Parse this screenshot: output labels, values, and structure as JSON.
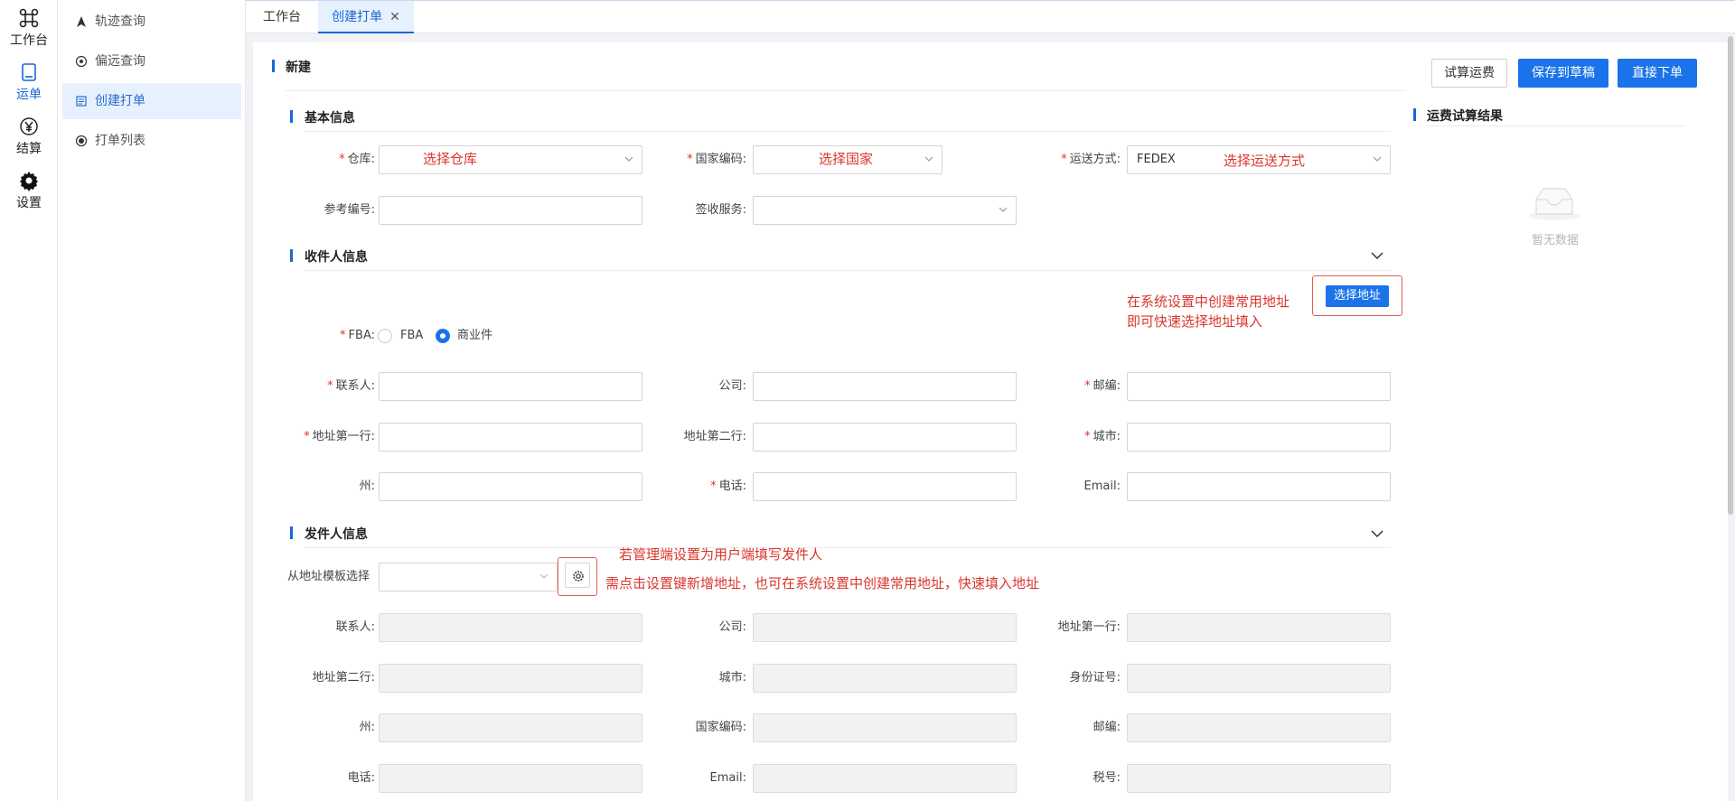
{
  "rail": {
    "items": [
      {
        "label": "工作台",
        "icon": "command-icon"
      },
      {
        "label": "运单",
        "icon": "tablet-icon"
      },
      {
        "label": "结算",
        "icon": "yen-icon"
      },
      {
        "label": "设置",
        "icon": "gear-icon"
      }
    ]
  },
  "submenu": {
    "items": [
      {
        "label": "轨迹查询"
      },
      {
        "label": "偏远查询"
      },
      {
        "label": "创建打单"
      },
      {
        "label": "打单列表"
      }
    ]
  },
  "tabs": [
    {
      "label": "工作台"
    },
    {
      "label": "创建打单"
    }
  ],
  "page": {
    "title": "新建",
    "buttons": {
      "trial": "试算运费",
      "save_draft": "保存到草稿",
      "submit": "直接下单"
    }
  },
  "basic": {
    "title": "基本信息",
    "warehouse_label": "仓库",
    "warehouse_hint": "选择仓库",
    "country_label": "国家编码",
    "country_hint": "选择国家",
    "shipping_label": "运送方式",
    "shipping_value": "FEDEX",
    "shipping_hint": "选择运送方式",
    "ref_label": "参考编号",
    "sign_label": "签收服务"
  },
  "recipient": {
    "title": "收件人信息",
    "choose_address_button": "选择地址",
    "annotation_line1": "在系统设置中创建常用地址",
    "annotation_line2": "即可快速选择地址填入",
    "fba_label": "FBA",
    "fba_option_fba": "FBA",
    "fba_option_commercial": "商业件",
    "contact_label": "联系人",
    "company_label": "公司",
    "postcode_label": "邮编",
    "addr1_label": "地址第一行",
    "addr2_label": "地址第二行",
    "city_label": "城市",
    "state_label": "州",
    "phone_label": "电话",
    "email_label": "Email"
  },
  "sender": {
    "title": "发件人信息",
    "template_label": "从地址模板选择",
    "annotation_line1": "若管理端设置为用户端填写发件人",
    "annotation_line2": "需点击设置键新增地址，也可在系统设置中创建常用地址，快速填入地址",
    "contact_label": "联系人",
    "company_label": "公司",
    "addr1_label": "地址第一行",
    "addr2_label": "地址第二行",
    "city_label": "城市",
    "id_label": "身份证号",
    "state_label": "州",
    "country_label": "国家编码",
    "postcode_label": "邮编",
    "phone_label": "电话",
    "email_label": "Email",
    "tax_label": "税号"
  },
  "trial_result": {
    "title": "运费试算结果",
    "empty_text": "暂无数据"
  },
  "colors": {
    "accent": "#1a73e8",
    "annotation": "#d9362c"
  }
}
